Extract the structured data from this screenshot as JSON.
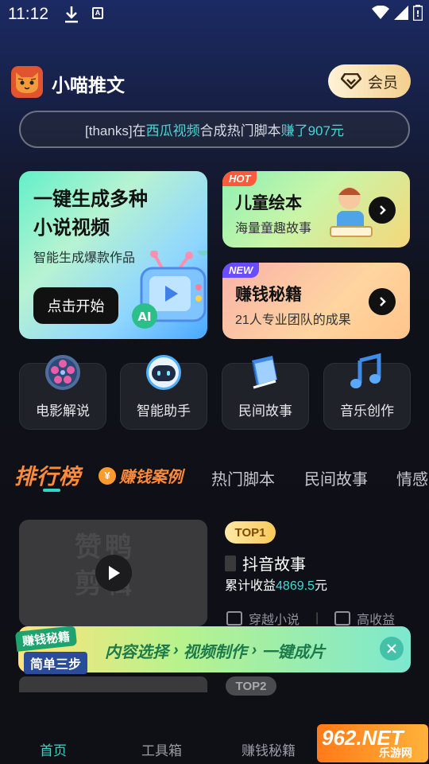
{
  "status_bar": {
    "time": "11:12"
  },
  "header": {
    "app_title": "小喵推文",
    "vip_label": "会员"
  },
  "ticker": {
    "prefix": "[thanks]在",
    "source": "西瓜视频",
    "middle": "合成热门脚本",
    "earned": "赚了907元"
  },
  "feature_card": {
    "title_line1": "一键生成多种",
    "title_line2": "小说视频",
    "subtitle": "智能生成爆款作品",
    "button": "点击开始"
  },
  "side_cards": [
    {
      "tag": "HOT",
      "title": "儿童绘本",
      "subtitle": "海量童趣故事"
    },
    {
      "tag": "NEW",
      "title": "赚钱秘籍",
      "subtitle": "21人专业团队的成果"
    }
  ],
  "shortcuts": [
    {
      "label": "电影解说",
      "icon": "film-reel-icon"
    },
    {
      "label": "智能助手",
      "icon": "robot-icon"
    },
    {
      "label": "民间故事",
      "icon": "book-icon"
    },
    {
      "label": "音乐创作",
      "icon": "music-note-icon"
    }
  ],
  "tabs": {
    "rank": "排行榜",
    "earn": "赚钱案例",
    "coin": "¥",
    "t3": "热门脚本",
    "t4": "民间故事",
    "t5": "情感"
  },
  "list_item": {
    "thumb_watermark_1": "赞鸭",
    "thumb_watermark_2": "剪辑",
    "badge": "TOP1",
    "title": "抖音故事",
    "earn_prefix": "累计收益",
    "earn_value": "4869.5",
    "earn_unit": "元",
    "tag1": "穿越小说",
    "tag2": "高收益"
  },
  "promo": {
    "left_top": "赚钱秘籍",
    "left_bottom": "简单三步",
    "step1": "内容选择",
    "step2": "视频制作",
    "step3": "一键成片"
  },
  "list_item_2": {
    "badge": "TOP2"
  },
  "bottom_nav": {
    "home": "首页",
    "tools": "工具箱",
    "secrets": "赚钱秘籍"
  },
  "watermark": {
    "brand": "962.NET",
    "sub": "乐游网"
  },
  "colors": {
    "accent": "#30d7c8",
    "orange": "#ff8a3a",
    "highlight": "#43d9d5"
  }
}
